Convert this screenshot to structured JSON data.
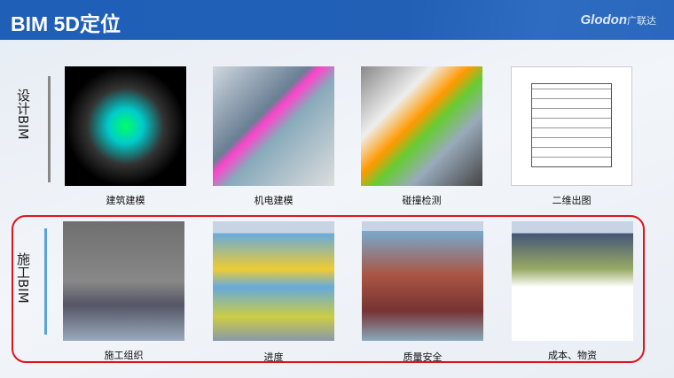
{
  "header": {
    "title": "BIM 5D定位",
    "logo_text": "Glodon",
    "logo_cn": "广联达"
  },
  "design": {
    "label": "设计BIM",
    "items": [
      {
        "caption": "建筑建模"
      },
      {
        "caption": "机电建模"
      },
      {
        "caption": "碰撞检测"
      },
      {
        "caption": "二维出图"
      }
    ]
  },
  "construction": {
    "label": "施工BIM",
    "items": [
      {
        "caption": "施工组织"
      },
      {
        "caption": "进度"
      },
      {
        "caption": "质量安全"
      },
      {
        "caption": "成本、物资"
      }
    ]
  },
  "colors": {
    "header": "#2160b5",
    "highlight": "#e0141c",
    "design_bar": "#888888",
    "construction_bar": "#5aa3dc"
  }
}
